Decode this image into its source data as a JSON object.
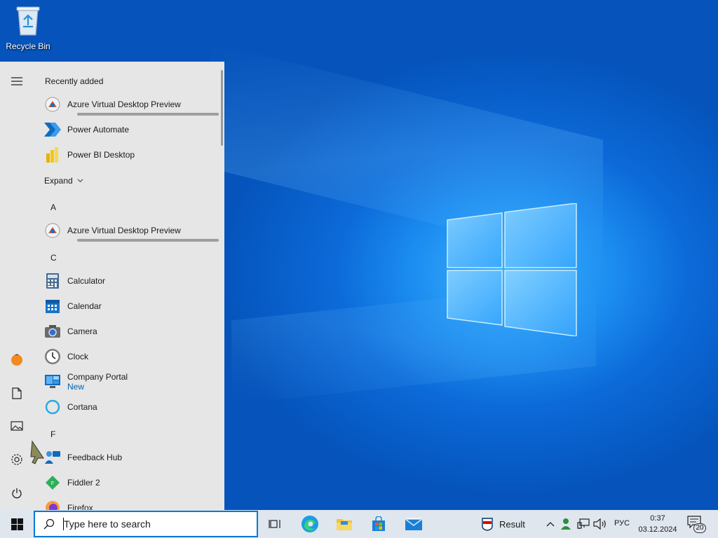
{
  "desktop": {
    "recycle_bin_label": "Recycle Bin"
  },
  "start_menu": {
    "recently_added_heading": "Recently added",
    "recently_added": [
      {
        "name": "Azure Virtual Desktop Preview",
        "icon": "azure-virtual-desktop-icon",
        "installing": true
      },
      {
        "name": "Power Automate",
        "icon": "power-automate-icon"
      },
      {
        "name": "Power BI Desktop",
        "icon": "power-bi-icon"
      }
    ],
    "expand_label": "Expand",
    "groups": [
      {
        "letter": "A",
        "apps": [
          {
            "name": "Azure Virtual Desktop Preview",
            "icon": "azure-virtual-desktop-icon",
            "installing": true
          }
        ]
      },
      {
        "letter": "C",
        "apps": [
          {
            "name": "Calculator",
            "icon": "calculator-icon"
          },
          {
            "name": "Calendar",
            "icon": "calendar-icon"
          },
          {
            "name": "Camera",
            "icon": "camera-icon"
          },
          {
            "name": "Clock",
            "icon": "clock-icon"
          },
          {
            "name": "Company Portal",
            "subtitle": "New",
            "icon": "company-portal-icon"
          },
          {
            "name": "Cortana",
            "icon": "cortana-icon"
          }
        ]
      },
      {
        "letter": "F",
        "apps": [
          {
            "name": "Feedback Hub",
            "icon": "feedback-hub-icon"
          },
          {
            "name": "Fiddler 2",
            "icon": "fiddler-icon"
          },
          {
            "name": "Firefox",
            "icon": "firefox-icon"
          }
        ]
      }
    ],
    "rail": [
      "hamburger-icon",
      "user-avatar-icon",
      "documents-icon",
      "pictures-icon",
      "settings-icon",
      "power-icon"
    ]
  },
  "taskbar": {
    "search_placeholder": "Type here to search",
    "pinned": [
      "task-view-icon",
      "edge-icon",
      "file-explorer-icon",
      "store-icon",
      "mail-icon"
    ],
    "tray": {
      "widget_label": "Result",
      "language": "РУС",
      "time": "0:37",
      "date": "03.12.2024",
      "notification_count": "20"
    }
  },
  "colors": {
    "accent": "#0078d7",
    "start_menu_bg": "#e6e6e6",
    "taskbar_bg": "#dfe6ee",
    "new_badge": "#0063b1"
  }
}
